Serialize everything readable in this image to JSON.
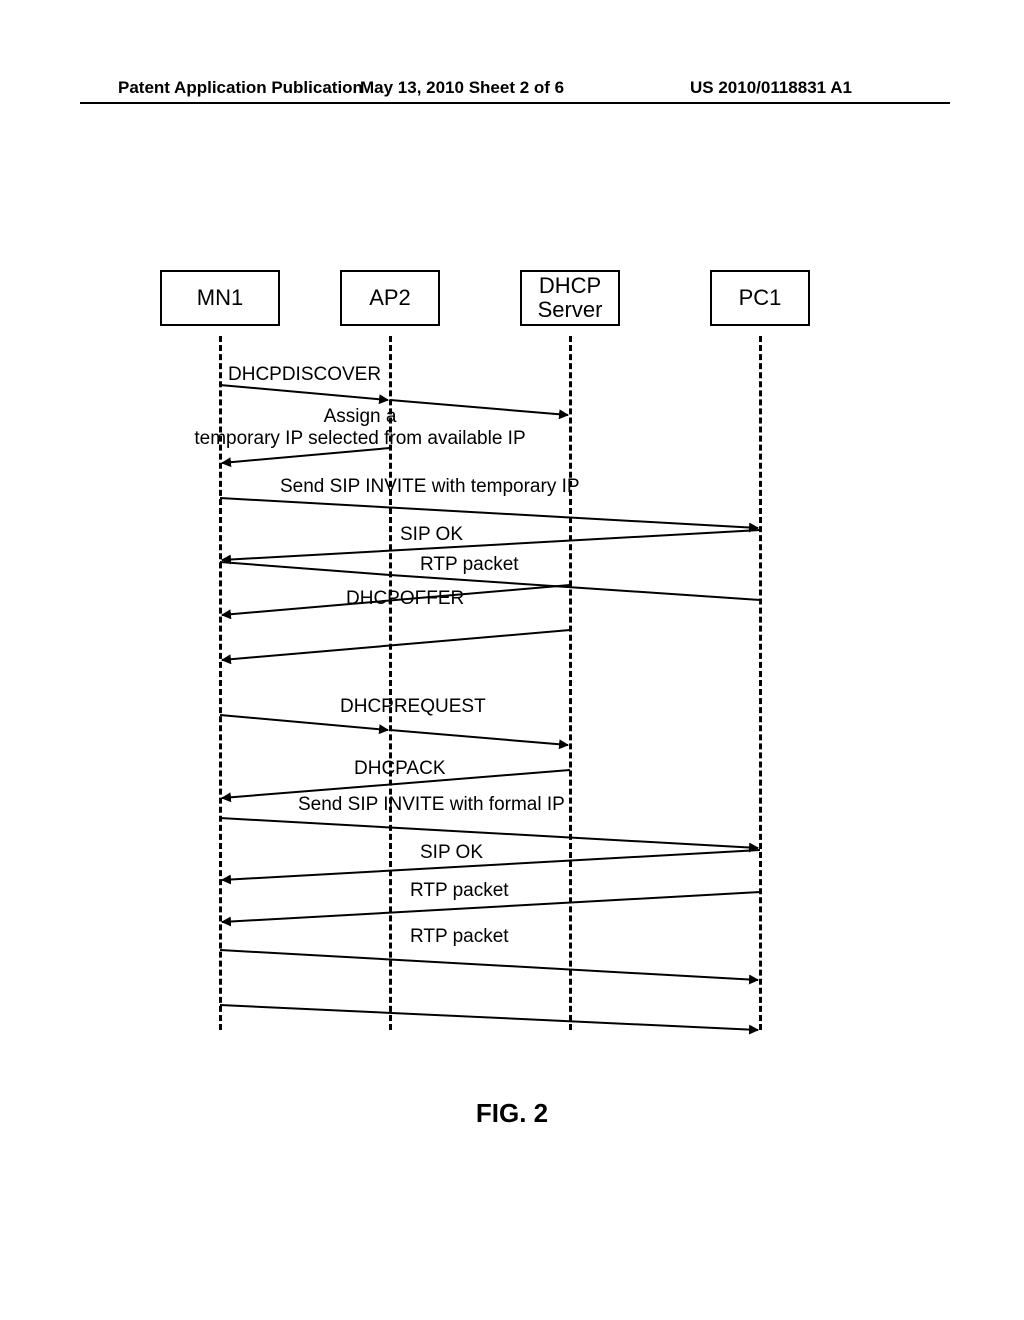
{
  "header": {
    "left": "Patent Application Publication",
    "center": "May 13, 2010  Sheet 2 of 6",
    "right": "US 2010/0118831 A1"
  },
  "actors": {
    "mn1": "MN1",
    "ap2": "AP2",
    "dhcp": "DHCP\nServer",
    "pc1": "PC1"
  },
  "messages": {
    "m1": "DHCPDISCOVER",
    "m2": "Assign a\ntemporary IP selected from available IP",
    "m3": "Send SIP INVITE with temporary IP",
    "m4": "SIP OK",
    "m5": "RTP packet",
    "m6": "DHCPOFFER",
    "m7": "DHCPREQUEST",
    "m8": "DHCPACK",
    "m9": "Send SIP INVITE with formal IP",
    "m10": "SIP OK",
    "m11": "RTP packet",
    "m12": "RTP packet"
  },
  "caption": "FIG. 2"
}
